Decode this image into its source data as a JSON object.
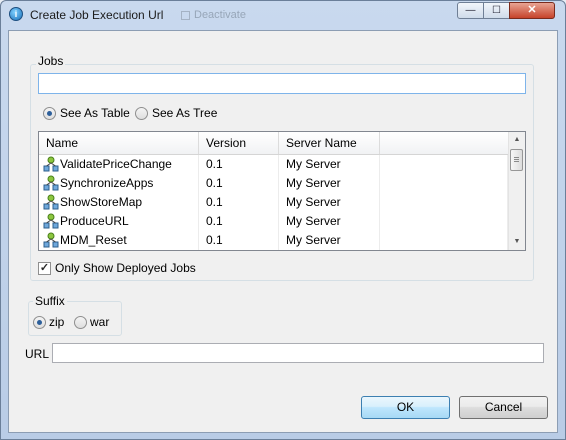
{
  "window": {
    "title": "Create Job Execution Url",
    "background_ghost": "Deactivate",
    "controls": {
      "minimize": "—",
      "maximize": "☐",
      "close": "✕"
    }
  },
  "jobs": {
    "group_label": "Jobs",
    "filter_value": "",
    "view_options": [
      {
        "label": "See As Table",
        "selected": true
      },
      {
        "label": "See As Tree",
        "selected": false
      }
    ],
    "table": {
      "columns": [
        "Name",
        "Version",
        "Server Name"
      ],
      "rows": [
        {
          "name": "ValidatePriceChange",
          "version": "0.1",
          "server": "My Server"
        },
        {
          "name": "SynchronizeApps",
          "version": "0.1",
          "server": "My Server"
        },
        {
          "name": "ShowStoreMap",
          "version": "0.1",
          "server": "My Server"
        },
        {
          "name": "ProduceURL",
          "version": "0.1",
          "server": "My Server"
        },
        {
          "name": "MDM_Reset",
          "version": "0.1",
          "server": "My Server"
        }
      ]
    },
    "only_deployed_label": "Only Show Deployed Jobs",
    "only_deployed_checked": true
  },
  "suffix": {
    "group_label": "Suffix",
    "options": [
      {
        "label": "zip",
        "selected": true
      },
      {
        "label": "war",
        "selected": false
      }
    ]
  },
  "url": {
    "label": "URL",
    "value": ""
  },
  "buttons": {
    "ok": "OK",
    "cancel": "Cancel"
  },
  "colors": {
    "accent": "#3c7fb1",
    "titlebar": "#c9d9ee",
    "close": "#c6432a"
  }
}
